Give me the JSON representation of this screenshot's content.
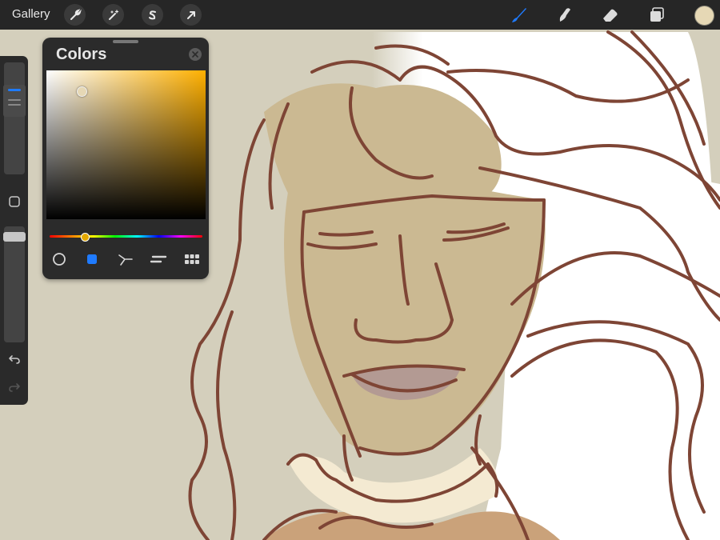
{
  "topbar": {
    "gallery_label": "Gallery",
    "left_tools": [
      "wrench-icon",
      "magic-wand-icon",
      "selection-s-icon",
      "transform-arrow-icon"
    ],
    "right_tools": [
      "brush-icon",
      "smudge-icon",
      "eraser-icon",
      "layers-icon"
    ],
    "active_tool": "brush",
    "current_color": "#e6d8b5"
  },
  "sidebar": {
    "brush_size": 0.72,
    "brush_opacity": 0.95
  },
  "colors_panel": {
    "title": "Colors",
    "selected_mode": "classic",
    "modes": [
      "disc",
      "classic",
      "harmony",
      "value",
      "palettes"
    ],
    "hue_color": "#ffb000",
    "accent": "#1f7bff"
  }
}
